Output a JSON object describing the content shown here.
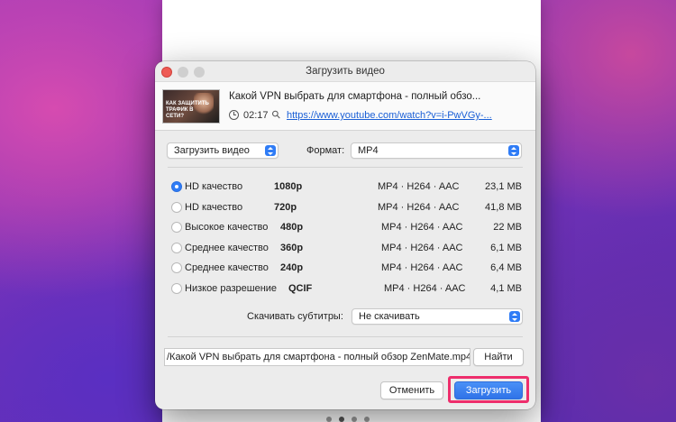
{
  "dialog": {
    "title": "Загрузить видео",
    "colors": {
      "accent": "#2f7cf6",
      "highlight": "#ee2e6c",
      "link": "#1a5fd6"
    }
  },
  "video": {
    "title": "Какой VPN выбрать для смартфона - полный обзо...",
    "duration": "02:17",
    "url": "https://www.youtube.com/watch?v=i-PwVGy-...",
    "thumbnail_text": "КАК ЗАЩИТИТЬ ТРАФИК В СЕТИ?"
  },
  "options": {
    "download_type": "Загрузить видео",
    "format_label": "Формат:",
    "format_value": "MP4"
  },
  "qualities": [
    {
      "name": "HD качество",
      "resolution": "1080p",
      "format": "MP4 · H264 · AAC",
      "size": "23,1 MB",
      "selected": true
    },
    {
      "name": "HD качество",
      "resolution": "720p",
      "format": "MP4 · H264 · AAC",
      "size": "41,8 MB",
      "selected": false
    },
    {
      "name": "Высокое качество",
      "resolution": "480p",
      "format": "MP4 · H264 · AAC",
      "size": "22 MB",
      "selected": false
    },
    {
      "name": "Среднее качество",
      "resolution": "360p",
      "format": "MP4 · H264 · AAC",
      "size": "6,1 MB",
      "selected": false
    },
    {
      "name": "Среднее качество",
      "resolution": "240p",
      "format": "MP4 · H264 · AAC",
      "size": "6,4 MB",
      "selected": false
    },
    {
      "name": "Низкое разрешение",
      "resolution": "QCIF",
      "format": "MP4 · H264 · AAC",
      "size": "4,1 MB",
      "selected": false
    }
  ],
  "subtitles": {
    "label": "Скачивать субтитры:",
    "value": "Не скачивать"
  },
  "save": {
    "path": "/Какой VPN выбрать для смартфона - полный обзор ZenMate.mp4",
    "browse_label": "Найти"
  },
  "actions": {
    "cancel_label": "Отменить",
    "download_label": "Загрузить"
  }
}
